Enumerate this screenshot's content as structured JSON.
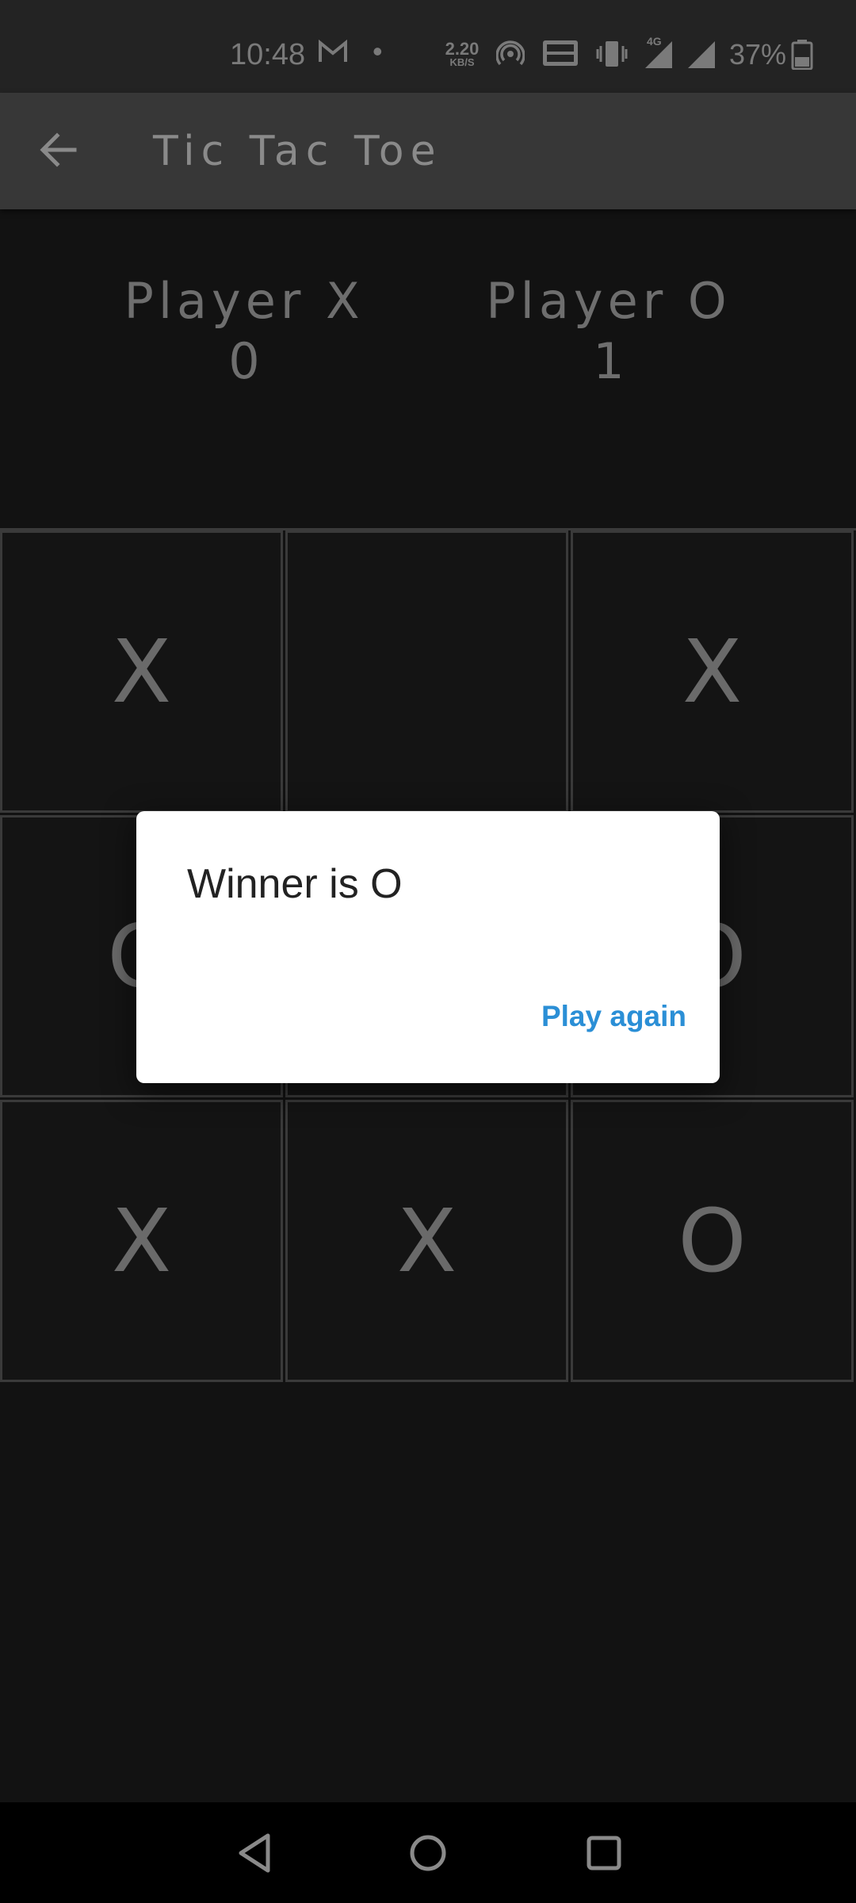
{
  "status_bar": {
    "time": "10:48",
    "speed_value": "2.20",
    "speed_unit": "KB/S",
    "battery": "37%",
    "network_label": "4G",
    "icons": [
      "gmail-icon",
      "dot-icon",
      "hotspot-icon",
      "volte-icon",
      "vibrate-icon",
      "signal-4g-icon",
      "signal-icon",
      "battery-icon"
    ]
  },
  "app_bar": {
    "title": "Tic Tac Toe",
    "back_icon": "arrow-back-icon"
  },
  "scores": {
    "player_x_label": "Player X",
    "player_x_score": "0",
    "player_o_label": "Player O",
    "player_o_score": "1"
  },
  "board": {
    "cells": [
      "X",
      "",
      "X",
      "O",
      "",
      "O",
      "X",
      "X",
      "O"
    ]
  },
  "dialog": {
    "title": "Winner is O",
    "action": "Play again"
  },
  "nav_bar": {
    "icons": [
      "back-triangle-icon",
      "home-circle-icon",
      "recents-square-icon"
    ]
  },
  "colors": {
    "background": "#121212",
    "app_bar": "#373737",
    "accent": "#2b8fd6",
    "dialog_bg": "#ffffff"
  }
}
